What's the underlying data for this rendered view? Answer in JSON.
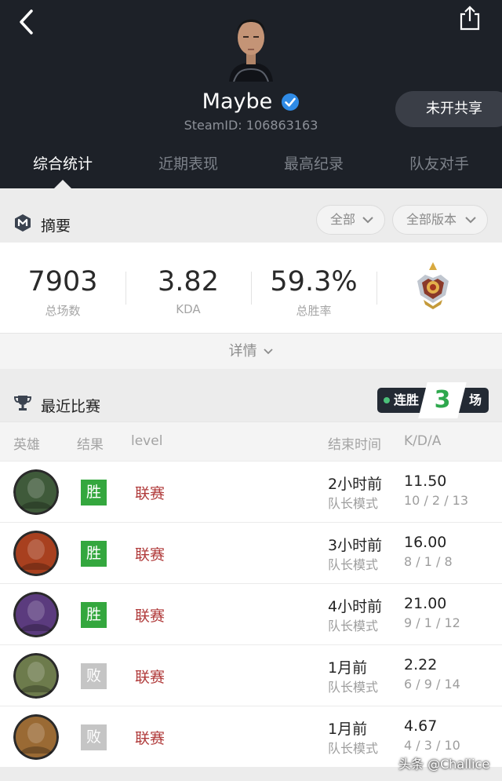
{
  "player": {
    "name": "Maybe",
    "steam_id": "SteamID: 106863163",
    "share_label": "未开共享"
  },
  "tabs": [
    {
      "label": "综合统计",
      "active": true
    },
    {
      "label": "近期表现",
      "active": false
    },
    {
      "label": "最高纪录",
      "active": false
    },
    {
      "label": "队友对手",
      "active": false
    }
  ],
  "summary": {
    "title": "摘要",
    "filter_mode": "全部",
    "filter_version": "全部版本",
    "stats": [
      {
        "value": "7903",
        "label": "总场数"
      },
      {
        "value": "3.82",
        "label": "KDA"
      },
      {
        "value": "59.3%",
        "label": "总胜率"
      }
    ],
    "details_label": "详情"
  },
  "recent": {
    "title": "最近比赛",
    "streak_label": "连胜",
    "streak_count": "3",
    "streak_unit": "场",
    "columns": [
      "英雄",
      "结果",
      "level",
      "结束时间",
      "K/D/A"
    ],
    "matches": [
      {
        "result": "胜",
        "win": true,
        "level": "联赛",
        "time": "2小时前",
        "mode": "队长模式",
        "kda": "11.50",
        "kda_detail": "10 / 2 / 13",
        "hero_color": "#3f5a3a"
      },
      {
        "result": "胜",
        "win": true,
        "level": "联赛",
        "time": "3小时前",
        "mode": "队长模式",
        "kda": "16.00",
        "kda_detail": "8 / 1 / 8",
        "hero_color": "#a8401f"
      },
      {
        "result": "胜",
        "win": true,
        "level": "联赛",
        "time": "4小时前",
        "mode": "队长模式",
        "kda": "21.00",
        "kda_detail": "9 / 1 / 12",
        "hero_color": "#5b3b7e"
      },
      {
        "result": "败",
        "win": false,
        "level": "联赛",
        "time": "1月前",
        "mode": "队长模式",
        "kda": "2.22",
        "kda_detail": "6 / 9 / 14",
        "hero_color": "#6d7b4c"
      },
      {
        "result": "败",
        "win": false,
        "level": "联赛",
        "time": "1月前",
        "mode": "队长模式",
        "kda": "4.67",
        "kda_detail": "4 / 3 / 10",
        "hero_color": "#9a6a34"
      }
    ]
  },
  "watermark": "头条 @Challice"
}
